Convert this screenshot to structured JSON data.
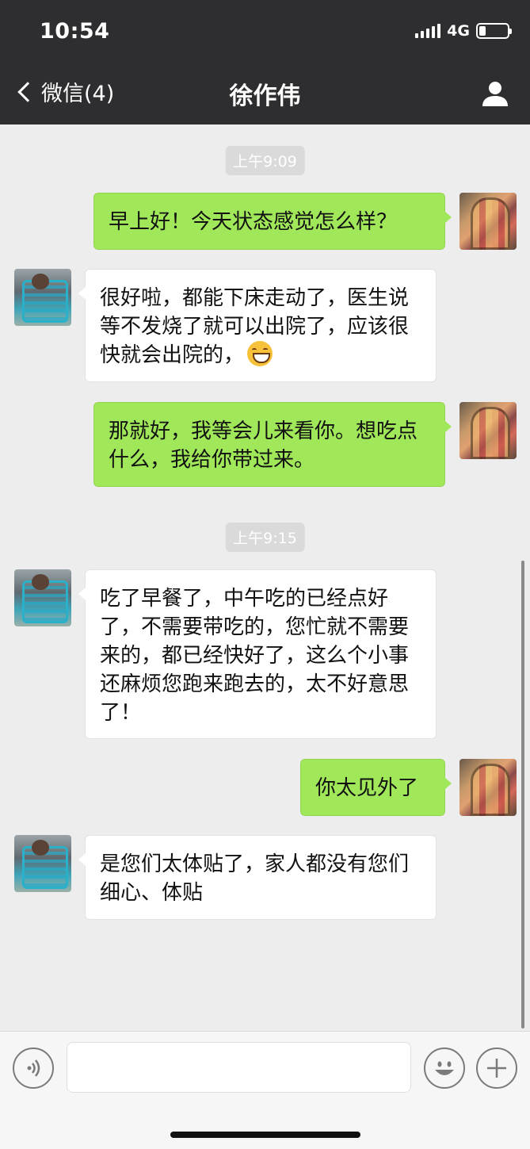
{
  "status_bar": {
    "time": "10:54",
    "network": "4G"
  },
  "nav": {
    "back_label": "微信(4)",
    "title": "徐作伟"
  },
  "chat": {
    "timestamps": [
      "上午9:09",
      "上午9:15"
    ],
    "messages": [
      {
        "sender": "me",
        "text": "早上好！今天状态感觉怎么样？"
      },
      {
        "sender": "other",
        "text": "很好啦，都能下床走动了，医生说等不发烧了就可以出院了，应该很快就会出院的，"
      },
      {
        "sender": "me",
        "text": "那就好，我等会儿来看你。想吃点什么，我给你带过来。"
      },
      {
        "sender": "other",
        "text": "吃了早餐了，中午吃的已经点好了，不需要带吃的，您忙就不需要来的，都已经快好了，这么个小事还麻烦您跑来跑去的，太不好意思了！"
      },
      {
        "sender": "me",
        "text": "你太见外了"
      },
      {
        "sender": "other",
        "text": "是您们太体贴了，家人都没有您们细心、体贴"
      }
    ]
  },
  "colors": {
    "header_bg": "#2e2e30",
    "bubble_me": "#a0e75a",
    "bubble_other": "#ffffff",
    "chat_bg": "#ededed"
  },
  "icons": [
    "chevron-left-icon",
    "person-icon",
    "voice-icon",
    "emoji-icon",
    "plus-icon",
    "grinning-emoji-icon"
  ]
}
